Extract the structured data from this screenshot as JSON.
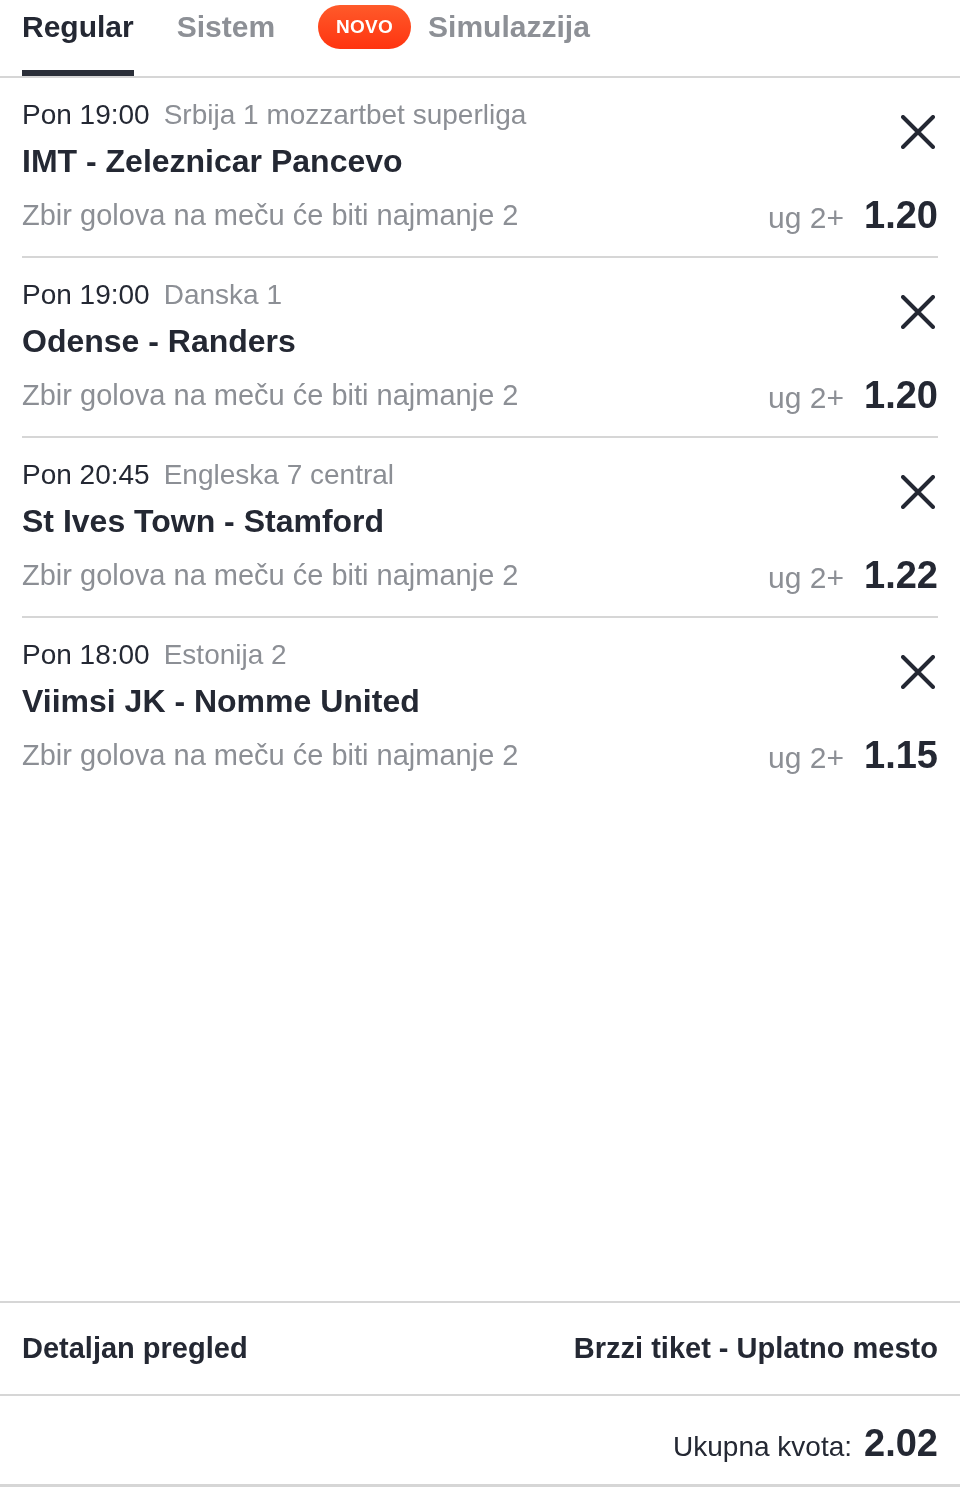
{
  "tabs": [
    {
      "label": "Regular",
      "selected": true
    },
    {
      "label": "Sistem",
      "selected": false
    },
    {
      "label": "Simulazzija",
      "selected": false,
      "badge": "NOVO"
    }
  ],
  "events": [
    {
      "time": "Pon 19:00",
      "league": "Srbija 1 mozzartbet superliga",
      "match": "IMT - Zeleznicar Pancevo",
      "market": "Zbir golova na meču će biti najmanje 2",
      "pick": "ug 2+",
      "odds": "1.20"
    },
    {
      "time": "Pon 19:00",
      "league": "Danska 1",
      "match": "Odense - Randers",
      "market": "Zbir golova na meču će biti najmanje 2",
      "pick": "ug 2+",
      "odds": "1.20"
    },
    {
      "time": "Pon 20:45",
      "league": "Engleska 7 central",
      "match": "St Ives Town - Stamford",
      "market": "Zbir golova na meču će biti najmanje 2",
      "pick": "ug 2+",
      "odds": "1.22"
    },
    {
      "time": "Pon 18:00",
      "league": "Estonija 2",
      "match": "Viimsi JK - Nomme United",
      "market": "Zbir golova na meču će biti najmanje 2",
      "pick": "ug 2+",
      "odds": "1.15"
    }
  ],
  "footer": {
    "links": [
      "Detaljan pregled",
      "Brzzi tiket - Uplatno mesto"
    ]
  },
  "total": {
    "label": "Ukupna kvota:",
    "value": "2.02"
  }
}
